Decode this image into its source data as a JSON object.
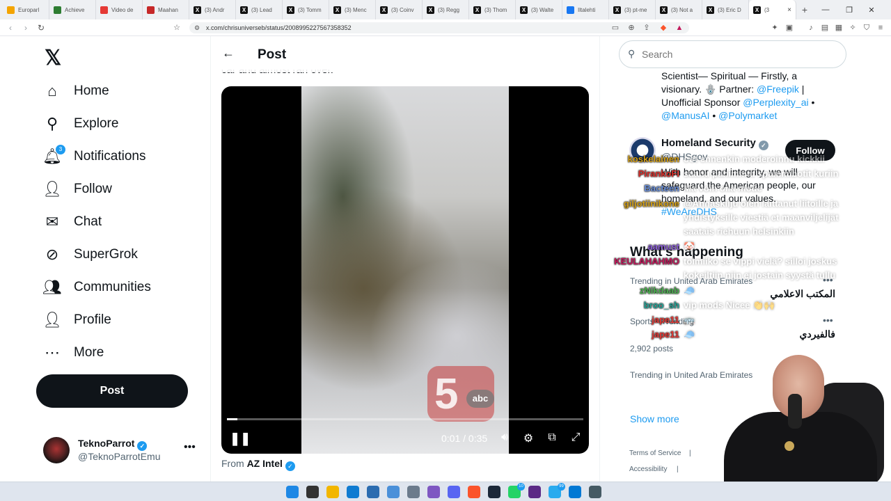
{
  "browser": {
    "tabs": [
      {
        "title": "Europarl",
        "icon": "europarl-icon",
        "color": "#f4a400"
      },
      {
        "title": "Achieve",
        "icon": "achievements-icon",
        "color": "#2e7d32"
      },
      {
        "title": "Video de",
        "icon": "youtube-icon",
        "color": "#e53935"
      },
      {
        "title": "Maahan",
        "icon": "news-icon",
        "color": "#c62828"
      },
      {
        "title": "(3) Andr",
        "icon": "x-icon",
        "color": "#111111"
      },
      {
        "title": "(3) Lead",
        "icon": "x-icon",
        "color": "#111111"
      },
      {
        "title": "(3) Tomm",
        "icon": "x-icon",
        "color": "#111111"
      },
      {
        "title": "(3) Menc",
        "icon": "x-icon",
        "color": "#111111"
      },
      {
        "title": "(3) Coinv",
        "icon": "x-icon",
        "color": "#111111"
      },
      {
        "title": "(3) Regg",
        "icon": "x-icon",
        "color": "#111111"
      },
      {
        "title": "(3) Thom",
        "icon": "x-icon",
        "color": "#111111"
      },
      {
        "title": "(3) Walte",
        "icon": "x-icon",
        "color": "#111111"
      },
      {
        "title": "Iltalehti",
        "icon": "facebook-icon",
        "color": "#1877f2"
      },
      {
        "title": "(3) pt-me",
        "icon": "x-icon",
        "color": "#111111"
      },
      {
        "title": "(3) Not a",
        "icon": "x-icon",
        "color": "#111111"
      },
      {
        "title": "(3) Eric D",
        "icon": "x-icon",
        "color": "#111111"
      },
      {
        "title": "(3",
        "icon": "x-icon",
        "color": "#111111",
        "active": true
      }
    ],
    "url": "x.com/chrisuniverseb/status/2008995227567358352"
  },
  "nav": {
    "items": [
      {
        "label": "Home",
        "icon": "home-icon",
        "glyph": "⌂"
      },
      {
        "label": "Explore",
        "icon": "search-icon",
        "glyph": "⚲"
      },
      {
        "label": "Notifications",
        "icon": "bell-icon",
        "glyph": "🔔︎",
        "badge": "3"
      },
      {
        "label": "Follow",
        "icon": "add-person-icon",
        "glyph": "👤︎"
      },
      {
        "label": "Chat",
        "icon": "mail-icon",
        "glyph": "✉"
      },
      {
        "label": "SuperGrok",
        "icon": "grok-icon",
        "glyph": "⊘"
      },
      {
        "label": "Communities",
        "icon": "communities-icon",
        "glyph": "👥︎"
      },
      {
        "label": "Profile",
        "icon": "person-icon",
        "glyph": "👤︎"
      },
      {
        "label": "More",
        "icon": "more-circle-icon",
        "glyph": "⋯"
      }
    ],
    "post_button": "Post",
    "account": {
      "name": "TeknoParrot",
      "handle": "@TeknoParrotEmu"
    }
  },
  "post": {
    "header_title": "Post",
    "cut_text": "car and almost ran over.",
    "video": {
      "time": "0:01 / 0:35",
      "progress": 0.03,
      "logo_number": "5",
      "logo_text": "abc"
    },
    "from_prefix": "From",
    "from_name": "AZ Intel"
  },
  "sidebar": {
    "search_placeholder": "Search",
    "bio1_text": "Scientist— Spiritual — Firstly, a visionary. 🪬 Partner: ",
    "bio1_link1": "@Freepik",
    "bio1_mid": " | Unofficial Sponsor ",
    "bio1_link2": "@Perplexity_ai",
    "bio1_sep": " • ",
    "bio1_link3": "@ManusAI",
    "bio1_sep2": " • ",
    "bio1_link4": "@Polymarket",
    "dhs": {
      "name": "Homeland Security",
      "handle": "@DHSgov",
      "follow": "Follow",
      "bio": "With honor and integrity, we will safeguard the American people, our homeland, and our values.",
      "hashtag": "#WeAreDHS"
    },
    "happening_title": "What's happening",
    "trends": [
      {
        "meta": "Trending in United Arab Emirates",
        "title": "المكتب الاعلامي"
      },
      {
        "meta": "Sports · Trending",
        "title": "فالفيردي",
        "posts": "2,902 posts"
      },
      {
        "meta": "Trending in United Arab Emirates",
        "title": ""
      }
    ],
    "show_more": "Show more",
    "footer": [
      "Terms of Service",
      "|",
      "Accessibility",
      "|"
    ]
  },
  "chat_overlay": [
    {
      "user": "koskelainen",
      "color": "#d4a017",
      "msg": "oot ennenkin moderoinnu kickkii"
    },
    {
      "user": "PirankoFI",
      "color": "#d9302c",
      "msg": "saanu pahimmat spammibotit kuriin"
    },
    {
      "user": "Bacteen",
      "color": "#6a8fd8",
      "msg": "Ma voin olla mode"
    },
    {
      "user": "giljotiinikone",
      "color": "#d4a017",
      "msg": "@Ahnaskiiju olen laittanut liitoille ja"
    },
    {
      "user": "",
      "color": "#ffffff",
      "msg": "yhdistyksille viestiä et maanviljelijät"
    },
    {
      "user": "",
      "color": "#ffffff",
      "msg": "saatais riehuun helsinkiin"
    },
    {
      "user": "aamust",
      "color": "#8a5cd6",
      "msg": "🤡"
    },
    {
      "user": "KEULAHAHMO",
      "color": "#c2185b",
      "msg": "toimiiko se vippi vielä? silloi joskus"
    },
    {
      "user": "",
      "color": "#ffffff",
      "msg": "kokeiltiin niin ei jostain syystä tullu"
    },
    {
      "user": "zNikdaab",
      "color": "#4caf50",
      "msg": "🧢"
    },
    {
      "user": "broo_sh",
      "color": "#26a69a",
      "msg": "vip mods Nicee 👏🙌"
    },
    {
      "user": "jape11",
      "color": "#e53935",
      "msg": "🚌"
    },
    {
      "user": "jape11",
      "color": "#e53935",
      "msg": "🧢"
    }
  ],
  "taskbar": {
    "apps": [
      {
        "name": "windows-start-icon",
        "color": "#1e88e5"
      },
      {
        "name": "task-view-icon",
        "color": "#333333"
      },
      {
        "name": "file-explorer-icon",
        "color": "#f2b600"
      },
      {
        "name": "edge-icon",
        "color": "#0f7bd1"
      },
      {
        "name": "store-icon",
        "color": "#2b6cb0"
      },
      {
        "name": "app-icon",
        "color": "#4a90d9"
      },
      {
        "name": "settings-icon",
        "color": "#6b7b8c"
      },
      {
        "name": "app-icon-2",
        "color": "#7e57c2"
      },
      {
        "name": "discord-icon",
        "color": "#5865f2"
      },
      {
        "name": "brave-icon",
        "color": "#fb542b"
      },
      {
        "name": "steam-icon",
        "color": "#1b2838"
      },
      {
        "name": "whatsapp-icon",
        "color": "#25d366",
        "badge": "10"
      },
      {
        "name": "app-icon-3",
        "color": "#5b2a86"
      },
      {
        "name": "telegram-icon",
        "color": "#2aabee",
        "badge": "99"
      },
      {
        "name": "vscode-icon",
        "color": "#0078d4"
      },
      {
        "name": "calculator-icon",
        "color": "#455a64"
      }
    ]
  }
}
